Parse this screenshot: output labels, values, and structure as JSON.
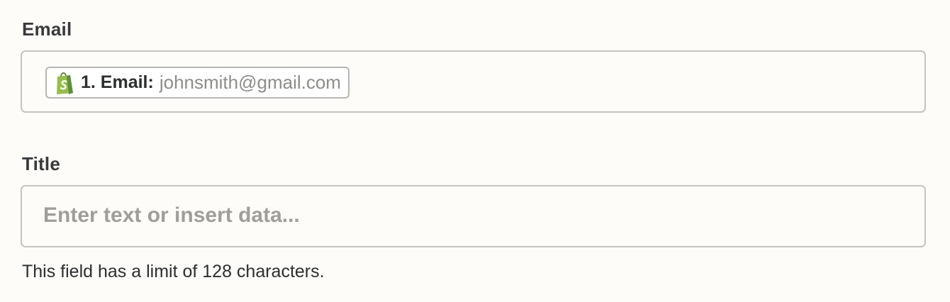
{
  "email_field": {
    "label": "Email",
    "pill": {
      "icon": "shopify-bag-icon",
      "key": "1. Email:",
      "value": "johnsmith@gmail.com",
      "icon_color": "#95bf47"
    }
  },
  "title_field": {
    "label": "Title",
    "placeholder": "Enter text or insert data...",
    "helper_text": "This field has a limit of 128 characters."
  }
}
